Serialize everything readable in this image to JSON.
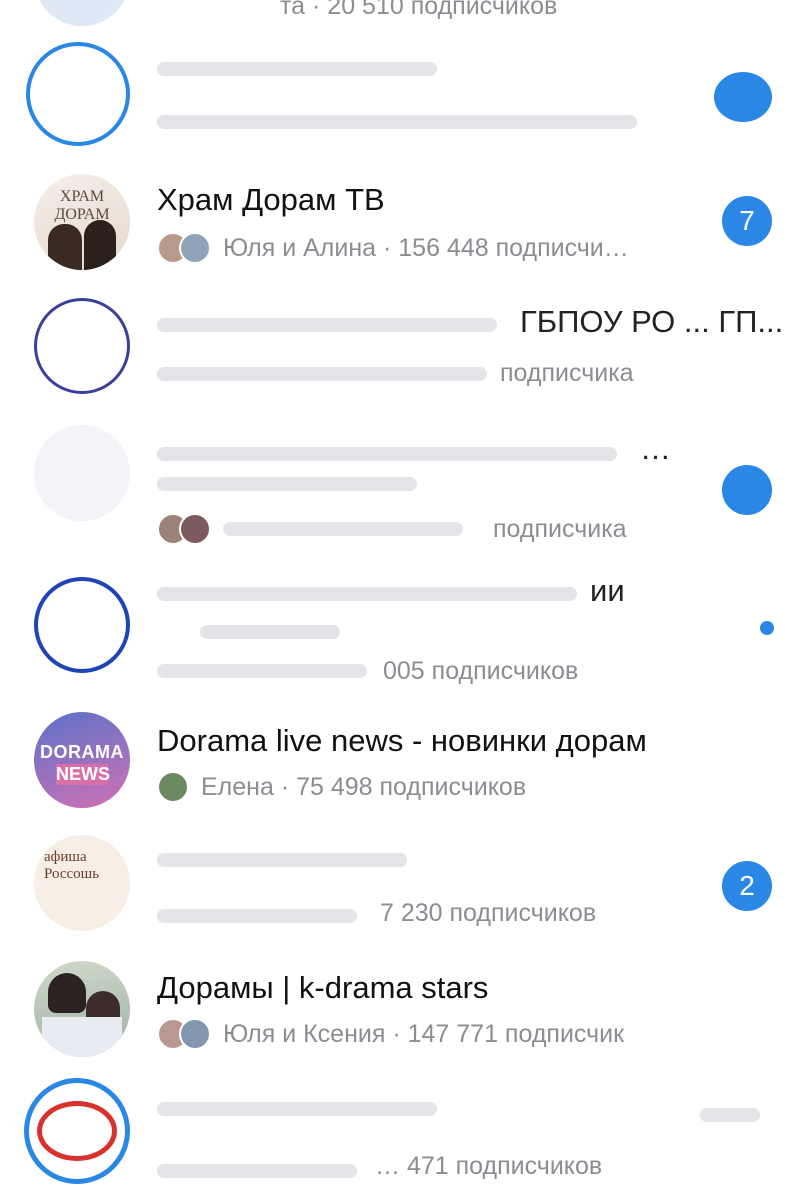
{
  "partial_top": {
    "subtitle_fragment": "та · 20 510 подписчиков"
  },
  "chats": [
    {
      "id": "hram",
      "title": "Храм Дорам ТВ",
      "subtitle": "Юля и Алина · 156 448 подписчи…",
      "badge": "7",
      "avatar_text": "ХРАМ ДОРАМ"
    },
    {
      "id": "obscured-1",
      "fragments": [
        "ГБПОУ РО ... ГП..."
      ]
    },
    {
      "id": "obscured-2",
      "fragments": [
        "подписчика"
      ]
    },
    {
      "id": "obscured-3",
      "fragments": [
        "…",
        "подписчика"
      ]
    },
    {
      "id": "obscured-4",
      "fragments": [
        "ии",
        "005 подписчиков"
      ]
    },
    {
      "id": "dorama-news",
      "title": "Dorama live news - новинки дорам",
      "subtitle": "Елена · 75 498 подписчиков",
      "avatar_text_1": "DORAMA",
      "avatar_text_2": "NEWS"
    },
    {
      "id": "afisha",
      "fragments": [
        "7 230 подписчиков"
      ],
      "badge": "2",
      "avatar_text": "афиша Россошь"
    },
    {
      "id": "k-drama",
      "title": "Дорамы | k-drama stars",
      "subtitle": "Юля и Ксения · 147 771 подписчик"
    },
    {
      "id": "obscured-5",
      "fragments": [
        "… 471 подписчиков"
      ]
    }
  ],
  "colors": {
    "accent": "#2a87e6",
    "secondary_text": "#8a8d92"
  }
}
